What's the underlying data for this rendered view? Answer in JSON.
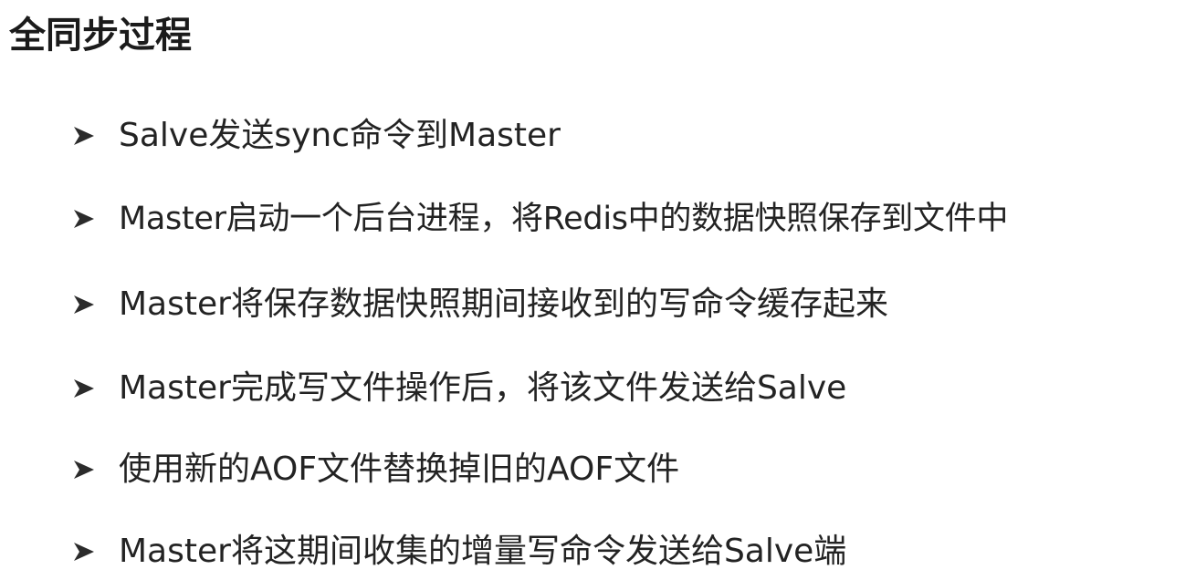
{
  "slide": {
    "title": "全同步过程",
    "bullets": [
      {
        "icon": "arrowhead-bullet-icon",
        "text": "Salve发送sync命令到Master"
      },
      {
        "icon": "arrowhead-bullet-icon",
        "text": "Master启动一个后台进程，将Redis中的数据快照保存到文件中"
      },
      {
        "icon": "arrowhead-bullet-icon",
        "text": "Master将保存数据快照期间接收到的写命令缓存起来"
      },
      {
        "icon": "arrowhead-bullet-icon",
        "text": "Master完成写文件操作后，将该文件发送给Salve"
      },
      {
        "icon": "arrowhead-bullet-icon",
        "text": "使用新的AOF文件替换掉旧的AOF文件"
      },
      {
        "icon": "arrowhead-bullet-icon",
        "text": "Master将这期间收集的增量写命令发送给Salve端"
      }
    ]
  },
  "colors": {
    "background": "#ffffff",
    "text": "#232323",
    "bullet": "#2b2b2b"
  }
}
